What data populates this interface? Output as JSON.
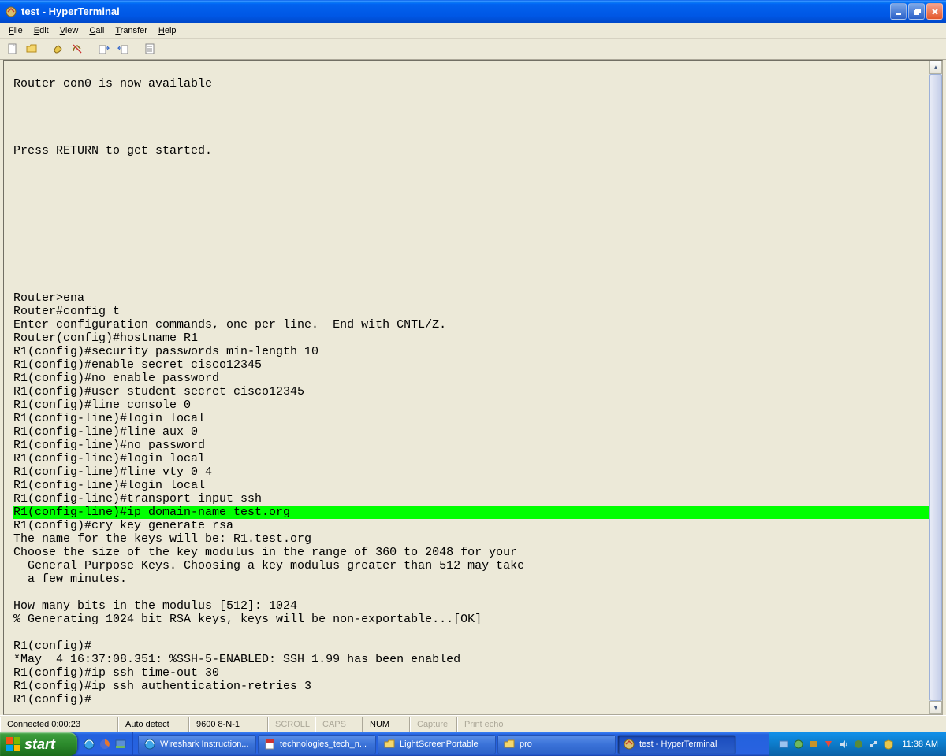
{
  "titlebar": {
    "title": "test - HyperTerminal"
  },
  "menus": [
    "File",
    "Edit",
    "View",
    "Call",
    "Transfer",
    "Help"
  ],
  "toolbar_icons": [
    "new-file",
    "open-file",
    "scissors-icon",
    "telephone-icon",
    "disconnect-icon",
    "send-icon",
    "properties-icon"
  ],
  "terminal": {
    "lines": [
      {
        "t": ""
      },
      {
        "t": "Router con0 is now available"
      },
      {
        "t": ""
      },
      {
        "t": ""
      },
      {
        "t": ""
      },
      {
        "t": ""
      },
      {
        "t": "Press RETURN to get started."
      },
      {
        "t": ""
      },
      {
        "t": ""
      },
      {
        "t": ""
      },
      {
        "t": ""
      },
      {
        "t": ""
      },
      {
        "t": ""
      },
      {
        "t": ""
      },
      {
        "t": ""
      },
      {
        "t": ""
      },
      {
        "t": ""
      },
      {
        "t": "Router>ena"
      },
      {
        "t": "Router#config t"
      },
      {
        "t": "Enter configuration commands, one per line.  End with CNTL/Z."
      },
      {
        "t": "Router(config)#hostname R1"
      },
      {
        "t": "R1(config)#security passwords min-length 10"
      },
      {
        "t": "R1(config)#enable secret cisco12345"
      },
      {
        "t": "R1(config)#no enable password"
      },
      {
        "t": "R1(config)#user student secret cisco12345"
      },
      {
        "t": "R1(config)#line console 0"
      },
      {
        "t": "R1(config-line)#login local"
      },
      {
        "t": "R1(config-line)#line aux 0"
      },
      {
        "t": "R1(config-line)#no password"
      },
      {
        "t": "R1(config-line)#login local"
      },
      {
        "t": "R1(config-line)#line vty 0 4"
      },
      {
        "t": "R1(config-line)#login local"
      },
      {
        "t": "R1(config-line)#transport input ssh"
      },
      {
        "t": "R1(config-line)#ip domain-name test.org                                     ",
        "hl": true
      },
      {
        "t": "R1(config)#cry key generate rsa"
      },
      {
        "t": "The name for the keys will be: R1.test.org"
      },
      {
        "t": "Choose the size of the key modulus in the range of 360 to 2048 for your"
      },
      {
        "t": "  General Purpose Keys. Choosing a key modulus greater than 512 may take"
      },
      {
        "t": "  a few minutes."
      },
      {
        "t": ""
      },
      {
        "t": "How many bits in the modulus [512]: 1024"
      },
      {
        "t": "% Generating 1024 bit RSA keys, keys will be non-exportable...[OK]"
      },
      {
        "t": ""
      },
      {
        "t": "R1(config)#"
      },
      {
        "t": "*May  4 16:37:08.351: %SSH-5-ENABLED: SSH 1.99 has been enabled"
      },
      {
        "t": "R1(config)#ip ssh time-out 30"
      },
      {
        "t": "R1(config)#ip ssh authentication-retries 3"
      },
      {
        "t": "R1(config)#"
      }
    ]
  },
  "statusbar": {
    "connected": "Connected 0:00:23",
    "detect": "Auto detect",
    "baud": "9600 8-N-1",
    "scroll": "SCROLL",
    "caps": "CAPS",
    "num": "NUM",
    "capture": "Capture",
    "echo": "Print echo"
  },
  "taskbar": {
    "start": "start",
    "items": [
      {
        "label": "Wireshark Instruction...",
        "icon": "ie"
      },
      {
        "label": "technologies_tech_n...",
        "icon": "pdf"
      },
      {
        "label": "LightScreenPortable",
        "icon": "folder"
      },
      {
        "label": "pro",
        "icon": "folder"
      },
      {
        "label": "test - HyperTerminal",
        "icon": "ht",
        "active": true
      }
    ],
    "clock": "11:38 AM"
  }
}
